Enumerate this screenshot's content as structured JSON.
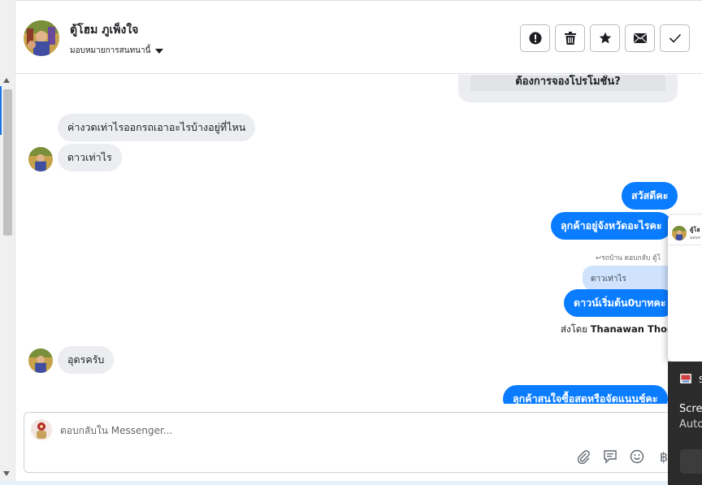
{
  "header": {
    "contact_name": "ตู้โฮม ภูเพ็งใจ",
    "assign_label": "มอบหมายการสนทนานี้",
    "actions": [
      {
        "name": "spam-button",
        "icon": "exclamation-icon"
      },
      {
        "name": "delete-button",
        "icon": "trash-icon"
      },
      {
        "name": "star-button",
        "icon": "star-icon"
      },
      {
        "name": "mark-unread-button",
        "icon": "envelope-icon"
      },
      {
        "name": "mark-done-button",
        "icon": "check-icon"
      }
    ]
  },
  "messages": {
    "promo_question": "ต้องการจองโปรโมชั่น?",
    "in_1": "ค่างวดเท่าไรออกรถเอาอะไรบ้างอยู่ที่ไหน",
    "in_2": "ดาวเท่าไร",
    "out_1": "สวัสดีคะ",
    "out_2": "ลุกค้าอยู่จังหวัดอะไรคะ",
    "reply_meta": "รถบ้าน ตอบกลับ ตู้โ",
    "quoted": "ดาวเท่าไร",
    "out_3": "ดาวน์เริ่มต้น0บาทคะ",
    "sent_by_prefix": "ส่งโดย",
    "sent_by_name": "Thanawan Thon",
    "in_3": "อุดรครับ",
    "out_4": "ลุกค้าสนใจซื้อสดหรือจัดแนนช์คะ"
  },
  "composer": {
    "placeholder": "ตอบกลับใน Messenger...",
    "icons": [
      "paperclip-icon",
      "saved-reply-icon",
      "emoji-icon",
      "baht-icon"
    ]
  },
  "popup": {
    "name": "ตู้โฮ",
    "sub": "มอบห"
  },
  "toast": {
    "title": "S",
    "line1": "Scre",
    "line2": "Auto"
  },
  "colors": {
    "outgoing": "#0a7cff",
    "incoming": "#ebedf0",
    "quote": "#cfe3ff"
  }
}
